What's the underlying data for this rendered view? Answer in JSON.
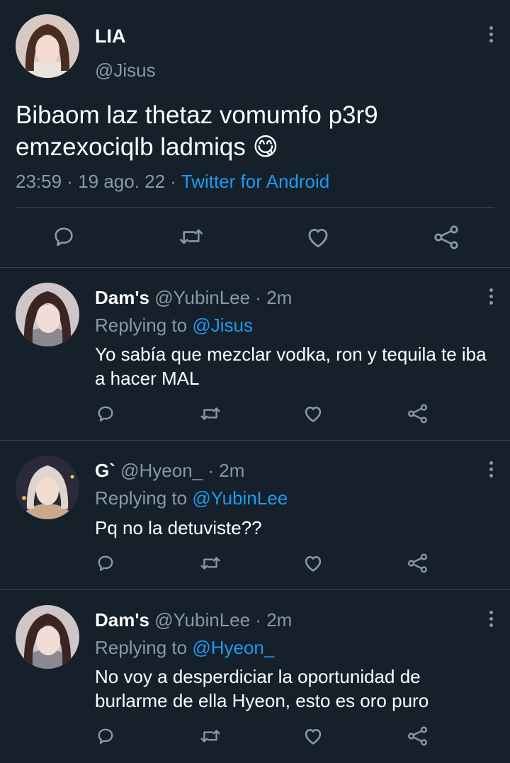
{
  "main_tweet": {
    "name": "LIA",
    "handle": "@Jisus",
    "text": "Bibaom laz thetaz vomumfo p3r9 emzexociqlb ladmiqs 😋",
    "time": "23:59",
    "date": "19 ago. 22",
    "source": "Twitter for Android",
    "separator": " · "
  },
  "replies": [
    {
      "name": "Dam's",
      "handle": "@YubinLee",
      "age": "2m",
      "replying_prefix": "Replying to ",
      "replying_to": "@Jisus",
      "text": "Yo sabía que mezclar vodka, ron y tequila te iba a hacer MAL"
    },
    {
      "name": "G`",
      "handle": "@Hyeon_",
      "age": "2m",
      "replying_prefix": "Replying to ",
      "replying_to": "@YubinLee",
      "text": "Pq no la detuviste??"
    },
    {
      "name": "Dam's",
      "handle": "@YubinLee",
      "age": "2m",
      "replying_prefix": "Replying to ",
      "replying_to": "@Hyeon_",
      "text": "No voy a desperdiciar la oportunidad de burlarme de ella Hyeon, esto es oro puro"
    }
  ],
  "icons": [
    "reply-icon",
    "retweet-icon",
    "like-icon",
    "share-icon",
    "more-options-icon"
  ],
  "colors": {
    "background": "#15202b",
    "text": "#ffffff",
    "secondary": "#8899a6",
    "link": "#1d9bf0",
    "divider": "#38444d"
  }
}
